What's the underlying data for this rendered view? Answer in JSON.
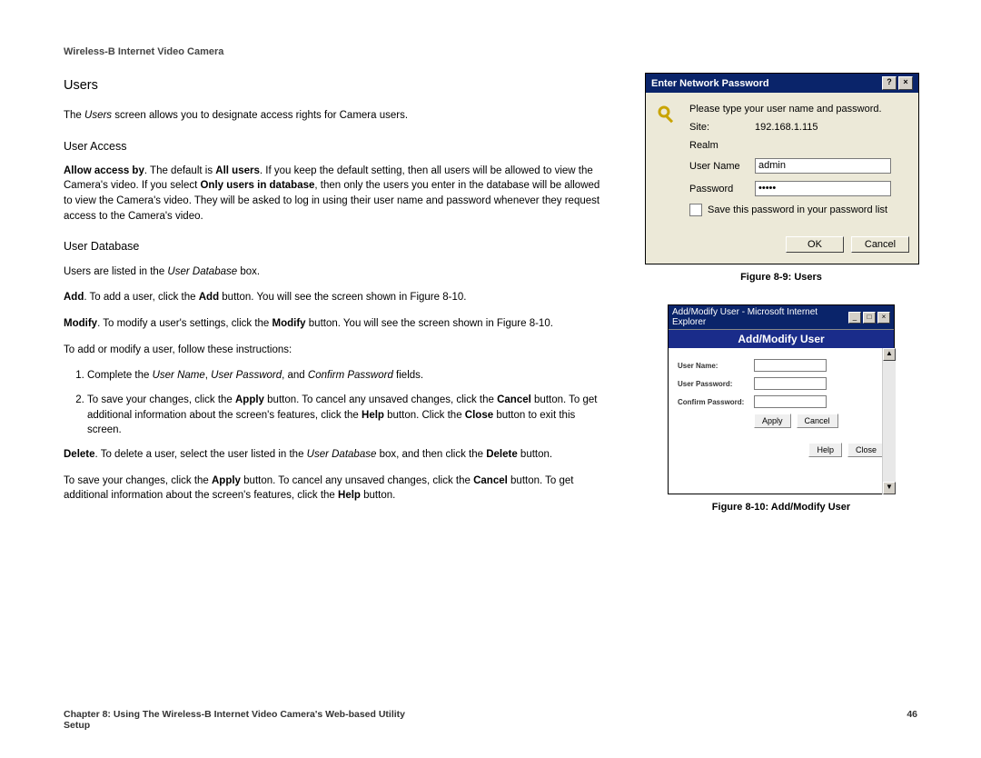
{
  "doc_header": "Wireless-B Internet Video Camera",
  "h1": "Users",
  "intro_a": "The ",
  "intro_users_i": "Users",
  "intro_b": " screen allows you to designate access rights for Camera users.",
  "h2_access": "User Access",
  "access_b1": "Allow access by",
  "access_p_1": ". The default is ",
  "access_b2": "All users",
  "access_p_2": ". If you keep the default setting, then all users will be allowed to view the Camera's video. If you select ",
  "access_b3": "Only users in database",
  "access_p_3": ", then only the users you enter in the database will be allowed to view the Camera's video. They will be asked to log in using their user name and password whenever they request access to the Camera's video.",
  "h2_db": "User Database",
  "db_p_pre": "Users are listed in the ",
  "db_p_i": "User Database",
  "db_p_post": " box.",
  "add_b": "Add",
  "add_t1": ". To add a user, click the ",
  "add_b2": "Add",
  "add_t2": " button. You will see the screen shown in Figure 8-10.",
  "mod_b": "Modify",
  "mod_t1": ". To modify a user's settings, click the ",
  "mod_b2": "Modify",
  "mod_t2": " button. You will see the screen shown in Figure 8-10.",
  "instr_lead": "To add or modify a user, follow these instructions:",
  "li1_a": "Complete the ",
  "li1_i1": "User Name",
  "li1_s1": ", ",
  "li1_i2": "User Password",
  "li1_s2": ", and ",
  "li1_i3": "Confirm Password",
  "li1_b": " fields.",
  "li2_a": "To save your changes, click the ",
  "li2_b1": "Apply",
  "li2_b": " button. To cancel any unsaved changes, click the ",
  "li2_b2": "Cancel",
  "li2_c": " button. To get additional information about the screen's features, click the ",
  "li2_b3": "Help",
  "li2_d": " button. Click the ",
  "li2_b4": "Close",
  "li2_e": " button to exit this screen.",
  "del_b": "Delete",
  "del_t1": ". To delete a user, select the user listed in the ",
  "del_i": "User Database",
  "del_t2": " box, and then click the ",
  "del_b2": "Delete",
  "del_t3": " button.",
  "final_a": "To save your changes, click the ",
  "final_b1": "Apply",
  "final_b": " button. To cancel any unsaved changes, click the ",
  "final_b2": "Cancel",
  "final_c": " button. To get additional information about the screen's features, click the ",
  "final_b3": "Help",
  "final_d": " button.",
  "fig89": {
    "title": "Enter Network Password",
    "prompt": "Please type your user name and password.",
    "site_l": "Site:",
    "site_v": "192.168.1.115",
    "realm_l": "Realm",
    "user_l": "User Name",
    "user_v": "admin",
    "pass_l": "Password",
    "pass_v": "•••••",
    "save_l": "Save this password in your password list",
    "ok": "OK",
    "cancel": "Cancel",
    "caption": "Figure 8-9: Users"
  },
  "fig810": {
    "wintitle": "Add/Modify User - Microsoft Internet Explorer",
    "header": "Add/Modify User",
    "uname": "User Name:",
    "upass": "User Password:",
    "cpass": "Confirm Password:",
    "apply": "Apply",
    "cancel": "Cancel",
    "help": "Help",
    "close": "Close",
    "caption": "Figure 8-10: Add/Modify User"
  },
  "footer_chapter": "Chapter 8: Using The Wireless-B Internet Video Camera's Web-based Utility",
  "footer_section": "Setup",
  "page_num": "46"
}
